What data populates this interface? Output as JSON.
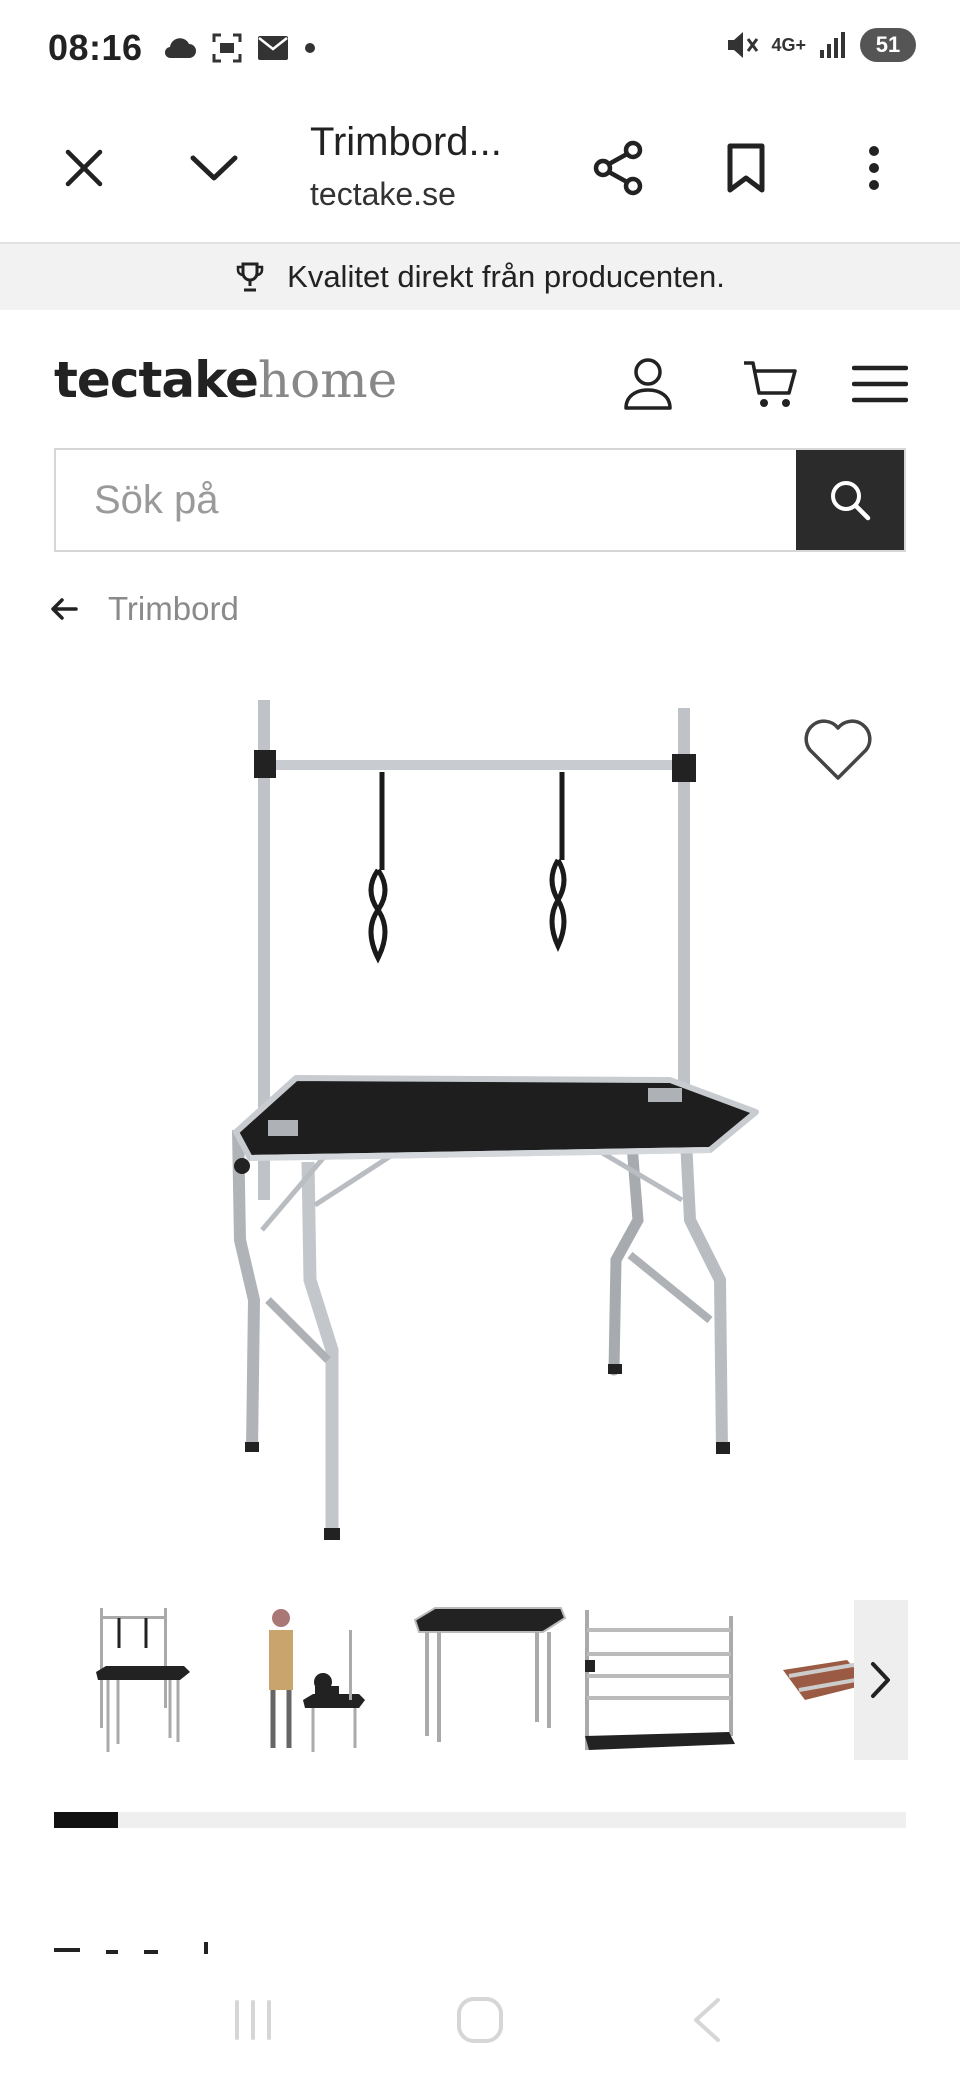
{
  "status_bar": {
    "time": "08:16",
    "network": "4G+",
    "battery": "51",
    "icons": [
      "cloud-icon",
      "screenshot-icon",
      "mail-icon",
      "dot-icon",
      "mute-icon",
      "signal-icon",
      "battery-icon"
    ]
  },
  "browser": {
    "title": "Trimbord...",
    "url": "tectake.se",
    "icons": [
      "close-icon",
      "chevron-down-icon",
      "share-icon",
      "bookmark-icon",
      "more-vert-icon"
    ]
  },
  "promo": {
    "text": "Kvalitet direkt från producenten.",
    "icon": "trophy-icon"
  },
  "header": {
    "logo_bold": "tectake",
    "logo_light": "home",
    "icons": [
      "account-icon",
      "cart-icon",
      "menu-icon"
    ]
  },
  "search": {
    "placeholder": "Sök på",
    "value": "",
    "icon": "search-icon"
  },
  "breadcrumb": {
    "label": "Trimbord",
    "icon": "back-arrow-icon"
  },
  "gallery": {
    "thumbnails": [
      "thumb-1",
      "thumb-2",
      "thumb-3",
      "thumb-4",
      "thumb-5"
    ],
    "progress": 0.075
  },
  "colors": {
    "accent_dark": "#2b2b2b",
    "promo_bg": "#f2f2f2",
    "metal": "#b9bdc2",
    "tabletop": "#1e1e1e"
  }
}
